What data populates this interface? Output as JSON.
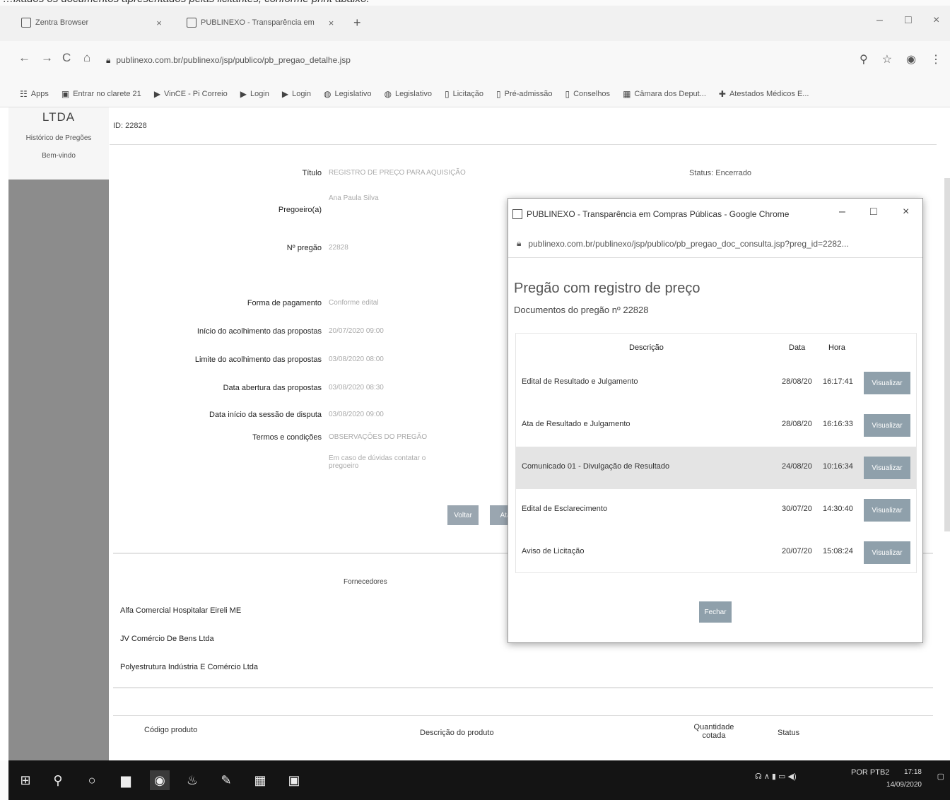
{
  "browser": {
    "tabs": [
      {
        "label": "Zentra Browser"
      },
      {
        "label": "PUBLINEXO - Transparência em"
      }
    ],
    "url": "publinexo.com.br/publinexo/jsp/publico/pb_pregao_detalhe.jsp",
    "bookmarks": [
      "Apps",
      "Entrar no clarete 21",
      "VinCE - Pi Correio",
      "Login",
      "Login",
      "Legislativo",
      "Legislativo",
      "Licitação",
      "Pré-admissão",
      "Conselhos",
      "Câmara dos Deput...",
      "Atestados Médicos E..."
    ]
  },
  "page": {
    "logo_text": "LTDA",
    "sidebar_links": [
      "Histórico de Pregões",
      "Bem-vindo"
    ],
    "id_label": "ID: 22828",
    "status_label": "Status: Encerrado",
    "form": {
      "fields": [
        {
          "label": "Título",
          "value": "REGISTRO DE PREÇO PARA AQUISIÇÃO"
        },
        {
          "label": "Pregoeiro(a)",
          "value": "Ana Paula Silva"
        },
        {
          "label": "Nº pregão",
          "value": "22828"
        },
        {
          "label": "Forma de pagamento",
          "value": "Conforme edital"
        },
        {
          "label": "Início do acolhimento das propostas",
          "value": "20/07/2020  09:00"
        },
        {
          "label": "Limite do acolhimento das propostas",
          "value": "03/08/2020  08:00"
        },
        {
          "label": "Data abertura das propostas",
          "value": "03/08/2020  08:30"
        },
        {
          "label": "Data início da sessão de disputa",
          "value": "03/08/2020  09:00"
        },
        {
          "label": "Termos e condições",
          "value": "OBSERVAÇÕES DO PREGÃO"
        }
      ],
      "note": "Em caso de dúvidas contatar o pregoeiro",
      "buttons": [
        "Voltar",
        "Ata"
      ]
    },
    "fornecedores_header": "Fornecedores",
    "fornecedores": [
      "Alfa Comercial Hospitalar Eireli ME",
      "JV Comércio De Bens Ltda",
      "Polyestrutura Indústria E Comércio Ltda"
    ],
    "products_table": {
      "headers": [
        "Código produto",
        "Descrição do produto",
        "Quantidade cotada",
        "Status"
      ]
    }
  },
  "popup": {
    "title": "PUBLINEXO - Transparência em Compras Públicas - Google Chrome",
    "url": "publinexo.com.br/publinexo/jsp/publico/pb_pregao_doc_consulta.jsp?preg_id=2282...",
    "heading": "Pregão com registro de preço",
    "subheading": "Documentos do pregão nº 22828",
    "table": {
      "headers": [
        "Descrição",
        "Data",
        "Hora"
      ],
      "rows": [
        {
          "descricao": "Edital de Resultado e Julgamento",
          "data": "28/08/20",
          "hora": "16:17:41",
          "action": "Visualizar"
        },
        {
          "descricao": "Ata de Resultado e Julgamento",
          "data": "28/08/20",
          "hora": "16:16:33",
          "action": "Visualizar"
        },
        {
          "descricao": "Comunicado 01 - Divulgação de Resultado",
          "data": "24/08/20",
          "hora": "10:16:34",
          "action": "Visualizar"
        },
        {
          "descricao": "Edital de Esclarecimento",
          "data": "30/07/20",
          "hora": "14:30:40",
          "action": "Visualizar"
        },
        {
          "descricao": "Aviso de Licitação",
          "data": "20/07/20",
          "hora": "15:08:24",
          "action": "Visualizar"
        }
      ]
    },
    "close_label": "Fechar"
  },
  "taskbar": {
    "language": "POR PTB2",
    "time": "17:18",
    "date": "14/09/2020"
  }
}
